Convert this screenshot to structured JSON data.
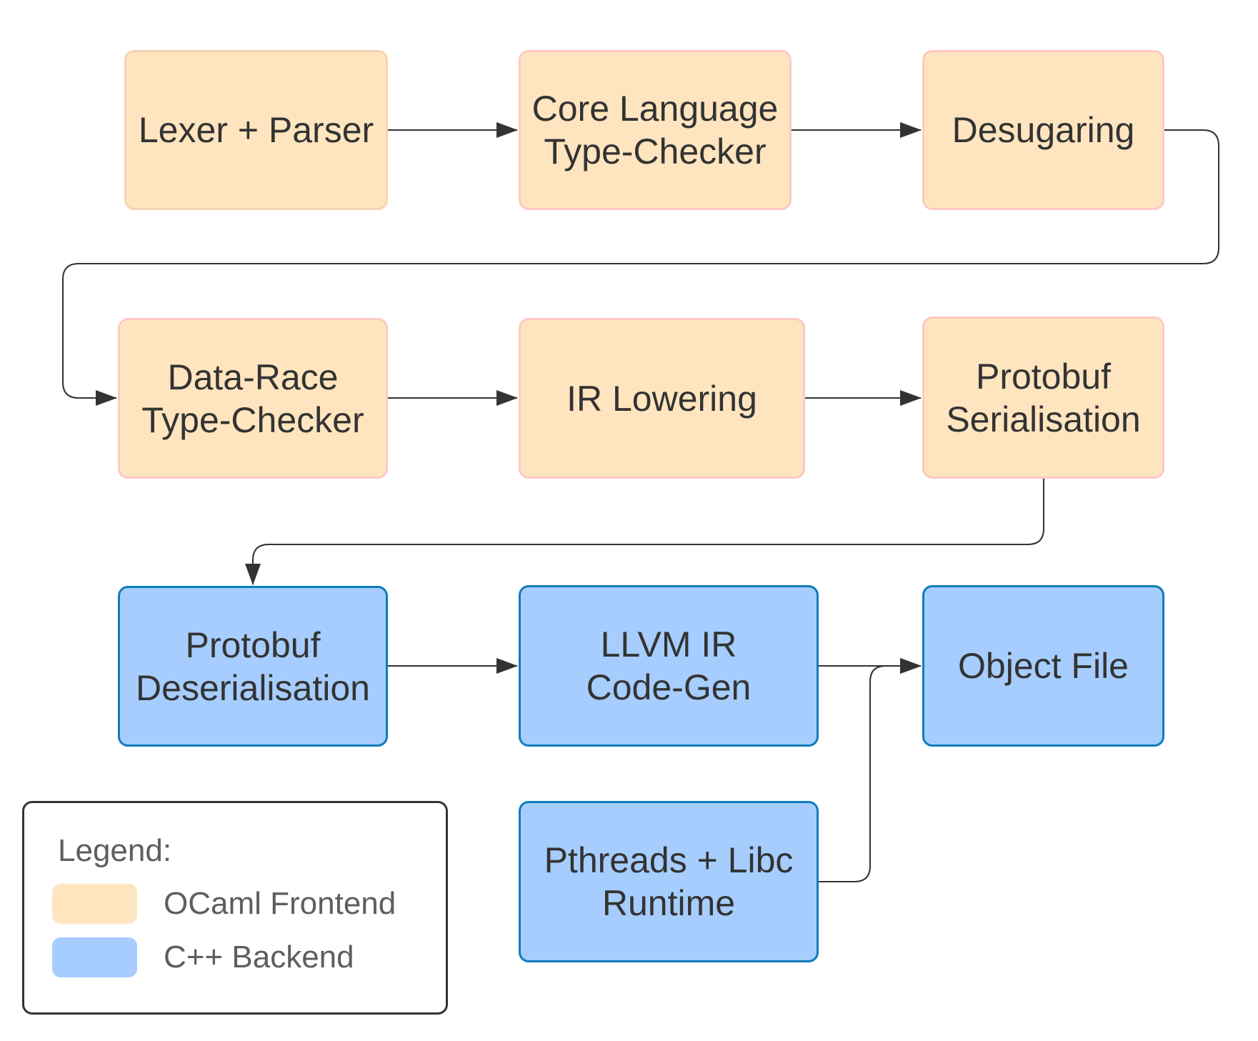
{
  "diagram": {
    "nodes": [
      {
        "id": "lexer-parser",
        "label": "Lexer + Parser",
        "group": "frontend"
      },
      {
        "id": "core-type-checker",
        "label": "Core Language\nType-Checker",
        "group": "frontend"
      },
      {
        "id": "desugaring",
        "label": "Desugaring",
        "group": "frontend"
      },
      {
        "id": "data-race-type-checker",
        "label": "Data-Race\nType-Checker",
        "group": "frontend"
      },
      {
        "id": "ir-lowering",
        "label": "IR Lowering",
        "group": "frontend"
      },
      {
        "id": "protobuf-serialisation",
        "label": "Protobuf\nSerialisation",
        "group": "frontend"
      },
      {
        "id": "protobuf-deserialisation",
        "label": "Protobuf\nDeserialisation",
        "group": "backend"
      },
      {
        "id": "llvm-ir-codegen",
        "label": "LLVM IR\nCode-Gen",
        "group": "backend"
      },
      {
        "id": "object-file",
        "label": "Object File",
        "group": "backend"
      },
      {
        "id": "pthreads-libc-runtime",
        "label": "Pthreads + Libc\nRuntime",
        "group": "backend"
      }
    ],
    "edges": [
      {
        "from": "lexer-parser",
        "to": "core-type-checker"
      },
      {
        "from": "core-type-checker",
        "to": "desugaring"
      },
      {
        "from": "desugaring",
        "to": "data-race-type-checker"
      },
      {
        "from": "data-race-type-checker",
        "to": "ir-lowering"
      },
      {
        "from": "ir-lowering",
        "to": "protobuf-serialisation"
      },
      {
        "from": "protobuf-serialisation",
        "to": "protobuf-deserialisation"
      },
      {
        "from": "protobuf-deserialisation",
        "to": "llvm-ir-codegen"
      },
      {
        "from": "llvm-ir-codegen",
        "to": "object-file"
      },
      {
        "from": "pthreads-libc-runtime",
        "to": "object-file"
      }
    ]
  },
  "legend": {
    "title": "Legend:",
    "entries": [
      {
        "label": "OCaml Frontend",
        "color": "#ffe5bf"
      },
      {
        "label": "C++ Backend",
        "color": "#a6cdfd"
      }
    ]
  },
  "colors": {
    "frontend_fill": "#ffe5bf",
    "frontend_border": "#fcc9c4",
    "backend_fill": "#a6cdfd",
    "backend_border": "#0f7cba",
    "connector": "#333333"
  }
}
